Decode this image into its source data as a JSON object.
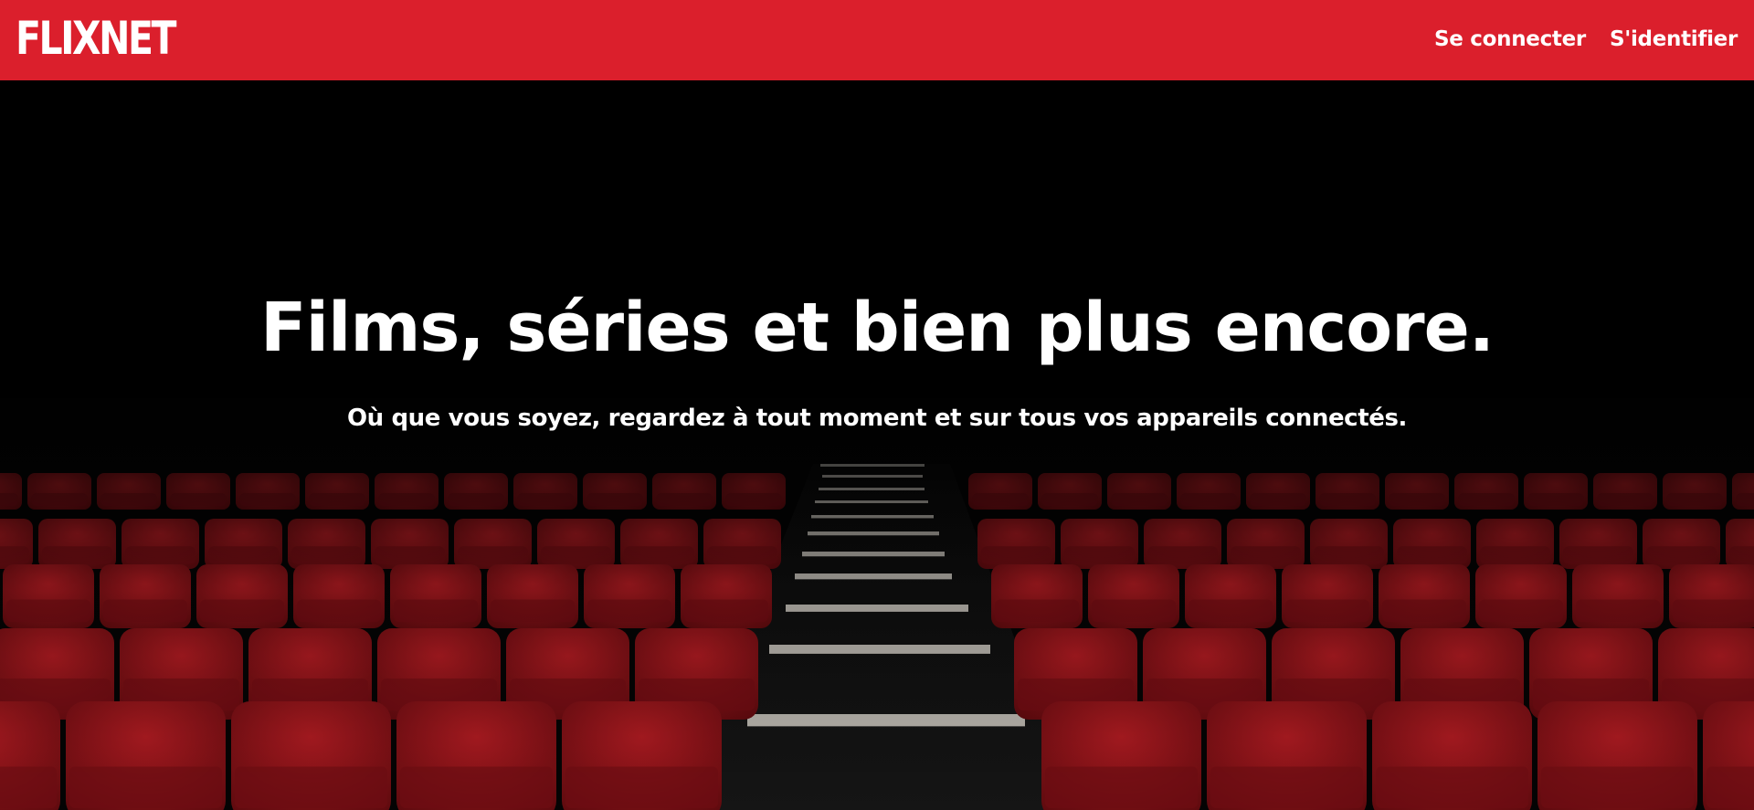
{
  "header": {
    "logo": "FLIXNET",
    "nav": {
      "login_label": "Se connecter",
      "signup_label": "S'identifier"
    }
  },
  "hero": {
    "title": "Films, séries et bien plus encore.",
    "subtitle": "Où que vous soyez, regardez à tout moment et sur tous vos appareils connectés.",
    "background": "cinema-seats-image"
  },
  "colors": {
    "brand": "#db1f2c",
    "text": "#ffffff",
    "background": "#000000",
    "seat": "#8e1419"
  }
}
